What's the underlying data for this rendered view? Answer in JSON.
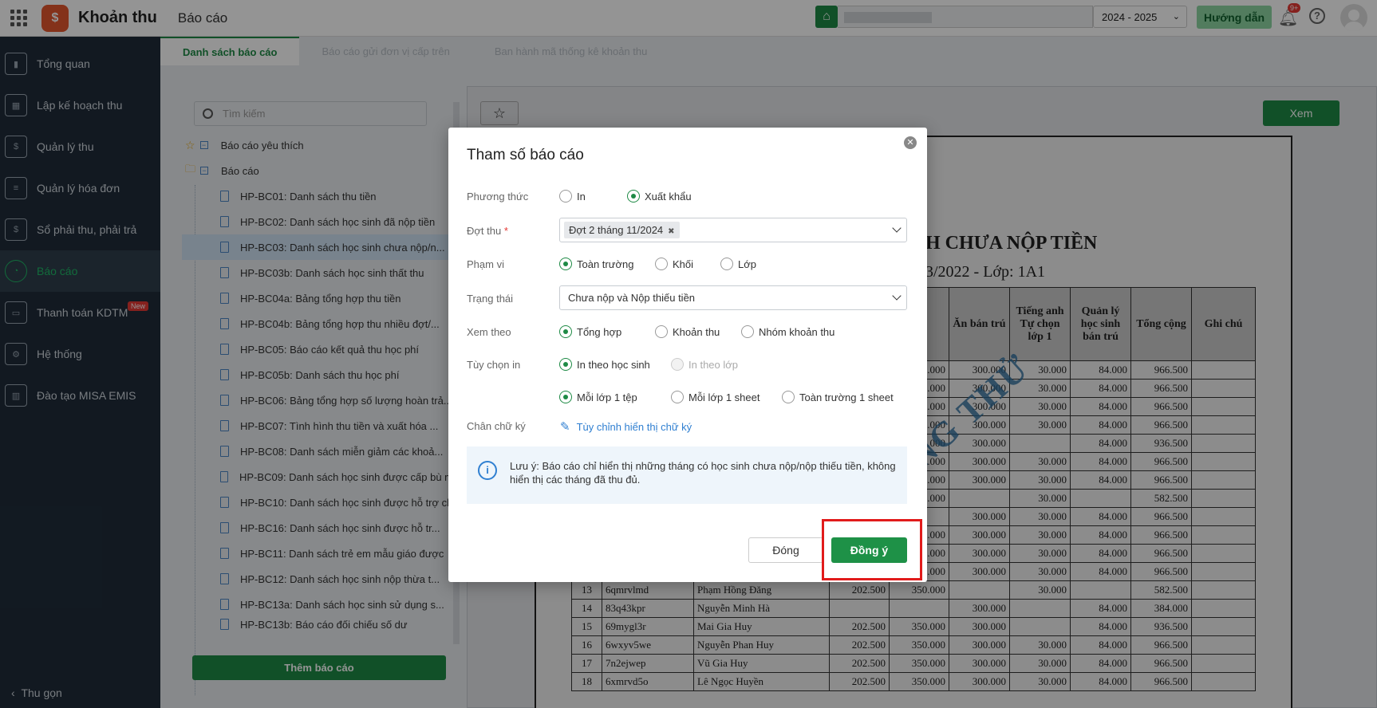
{
  "topbar": {
    "app_title": "Khoản thu",
    "page_title": "Báo cáo",
    "school_year": "2024 - 2025",
    "guide_label": "Hướng dẫn",
    "notif_count": "9+",
    "help_label": "?"
  },
  "sidebar": {
    "items": [
      {
        "label": "Tổng quan",
        "icon": "chart-icon"
      },
      {
        "label": "Lập kế hoạch thu",
        "icon": "calendar-icon"
      },
      {
        "label": "Quản lý thu",
        "icon": "money-hand-icon"
      },
      {
        "label": "Quản lý hóa đơn",
        "icon": "invoice-icon"
      },
      {
        "label": "Sổ phải thu, phải trả",
        "icon": "ledger-icon"
      },
      {
        "label": "Báo cáo",
        "icon": "pie-chart-icon",
        "active": true
      },
      {
        "label": "Thanh toán KDTM",
        "icon": "payment-icon",
        "badge": "New"
      },
      {
        "label": "Hệ thống",
        "icon": "gear-icon"
      },
      {
        "label": "Đào tạo MISA EMIS",
        "icon": "book-icon"
      }
    ],
    "collapse_label": "Thu gọn"
  },
  "tabs": [
    "Danh sách báo cáo",
    "Báo cáo gửi đơn vị cấp trên",
    "Ban hành mã thống kê khoản thu"
  ],
  "left": {
    "search_placeholder": "Tìm kiếm",
    "favorites_label": "Báo cáo yêu thích",
    "reports_label": "Báo cáo",
    "reports": [
      "HP-BC01: Danh sách thu tiền",
      "HP-BC02: Danh sách học sinh đã nộp tiền",
      "HP-BC03: Danh sách học sinh chưa nộp/n...",
      "HP-BC03b: Danh sách học sinh thất thu",
      "HP-BC04a: Bảng tổng hợp thu tiền",
      "HP-BC04b: Bảng tổng hợp thu nhiều đợt/...",
      "HP-BC05: Báo cáo kết quả thu học phí",
      "HP-BC05b: Danh sách thu học phí",
      "HP-BC06: Bảng tổng hợp số lượng hoàn trả...",
      "HP-BC07: Tình hình thu tiền và xuất hóa ...",
      "HP-BC08: Danh sách miễn giảm các khoả...",
      "HP-BC09: Danh sách học sinh được cấp bù m",
      "HP-BC10: Danh sách học sinh được hỗ trợ ch",
      "HP-BC16: Danh sách học sinh được hỗ tr...",
      "HP-BC11: Danh sách trẻ em mẫu giáo được",
      "HP-BC12: Danh sách học sinh nộp thừa t...",
      "HP-BC13a: Danh sách học sinh sử dụng s...",
      "HP-BC13b: Báo cáo đối chiếu số dư"
    ],
    "add_label": "Thêm báo cáo"
  },
  "preview": {
    "view_label": "Xem",
    "title": "H CHƯA NỘP TIỀN",
    "subtitle": "3/2022  -  Lớp: 1A1",
    "headers": [
      "Ăn bán trú",
      "Tiếng anh Tự chọn lớp 1",
      "Quản lý học sinh bán trú",
      "Tổng cộng",
      "Ghi chú"
    ],
    "rows_right": [
      [
        "50.000",
        "300.000",
        "30.000",
        "84.000",
        "966.500"
      ],
      [
        "50.000",
        "300.000",
        "30.000",
        "84.000",
        "966.500"
      ],
      [
        "50.000",
        "300.000",
        "30.000",
        "84.000",
        "966.500"
      ],
      [
        "50.000",
        "300.000",
        "30.000",
        "84.000",
        "966.500"
      ],
      [
        "50.000",
        "300.000",
        "",
        "84.000",
        "936.500"
      ],
      [
        "50.000",
        "300.000",
        "30.000",
        "84.000",
        "966.500"
      ],
      [
        "50.000",
        "300.000",
        "30.000",
        "84.000",
        "966.500"
      ],
      [
        "50.000",
        "",
        "30.000",
        "",
        "582.500"
      ],
      [
        "",
        "300.000",
        "30.000",
        "84.000",
        "966.500"
      ],
      [
        "50.000",
        "300.000",
        "30.000",
        "84.000",
        "966.500"
      ],
      [
        "50.000",
        "300.000",
        "30.000",
        "84.000",
        "966.500"
      ],
      [
        "50.000",
        "300.000",
        "30.000",
        "84.000",
        "966.500"
      ]
    ],
    "rows_full": [
      [
        "13",
        "6qmrvlmd",
        "Phạm Hồng Đăng",
        "202.500",
        "350.000",
        "",
        "30.000",
        "",
        "582.500"
      ],
      [
        "14",
        "83q43kpr",
        "Nguyễn Minh Hà",
        "",
        "",
        "300.000",
        "",
        "84.000",
        "384.000"
      ],
      [
        "15",
        "69mygl3r",
        "Mai Gia Huy",
        "202.500",
        "350.000",
        "300.000",
        "",
        "84.000",
        "936.500"
      ],
      [
        "16",
        "6wxyv5we",
        "Nguyễn Phan Huy",
        "202.500",
        "350.000",
        "300.000",
        "30.000",
        "84.000",
        "966.500"
      ],
      [
        "17",
        "7n2ejwep",
        "Vũ Gia Huy",
        "202.500",
        "350.000",
        "300.000",
        "30.000",
        "84.000",
        "966.500"
      ],
      [
        "18",
        "6xmrvd5o",
        "Lê Ngọc Huyền",
        "202.500",
        "350.000",
        "300.000",
        "30.000",
        "84.000",
        "966.500"
      ]
    ],
    "watermark": "BẢN DÙNG THỬ"
  },
  "dialog": {
    "title": "Tham số báo cáo",
    "method_label": "Phương thức",
    "method_options": [
      "In",
      "Xuất khẩu"
    ],
    "period_label": "Đợt thu",
    "period_required": "*",
    "period_chip": "Đợt 2 tháng 11/2024",
    "scope_label": "Phạm vi",
    "scope_options": [
      "Toàn trường",
      "Khối",
      "Lớp"
    ],
    "status_label": "Trạng thái",
    "status_value": "Chưa nộp và Nộp thiếu tiền",
    "viewby_label": "Xem theo",
    "viewby_options": [
      "Tổng hợp",
      "Khoản thu",
      "Nhóm khoản thu"
    ],
    "print_label": "Tùy chọn in",
    "print_options": [
      "In theo học sinh",
      "In theo lớp"
    ],
    "file_options": [
      "Mỗi lớp 1 tệp",
      "Mỗi lớp 1 sheet",
      "Toàn trường 1 sheet"
    ],
    "signature_label": "Chân chữ ký",
    "signature_link": "Tùy chỉnh hiển thị chữ ký",
    "note_text": "Lưu ý: Báo cáo chỉ hiển thị những tháng có học sinh chưa nộp/nộp thiếu tiền, không hiển thị các tháng đã thu đủ.",
    "close_label": "Đóng",
    "ok_label": "Đồng ý"
  }
}
